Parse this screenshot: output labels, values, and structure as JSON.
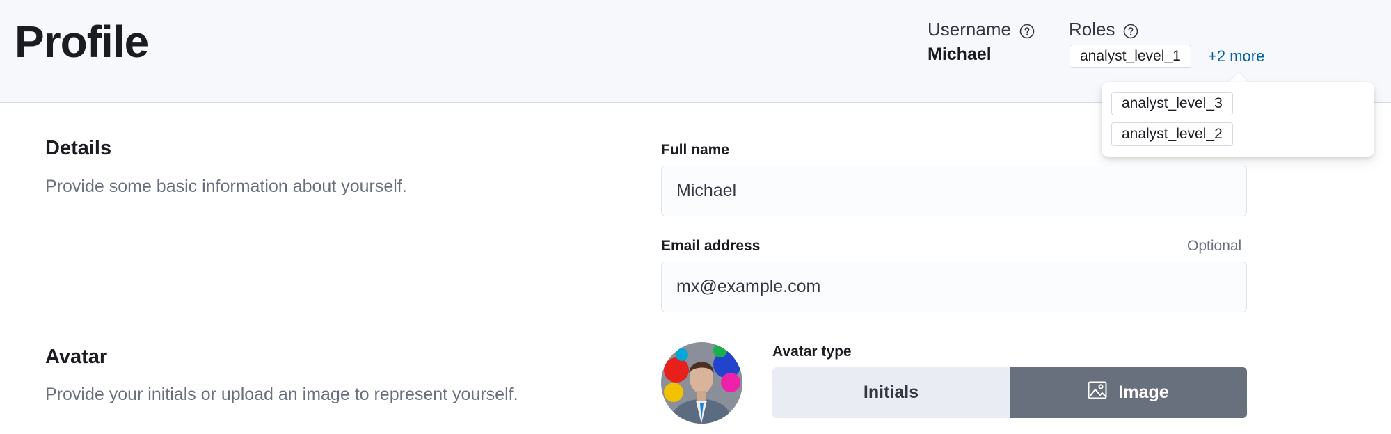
{
  "page": {
    "title": "Profile"
  },
  "header": {
    "username_label": "Username",
    "username_value": "Michael",
    "roles_label": "Roles",
    "roles": [
      "analyst_level_1"
    ],
    "more_link": "+2 more",
    "popover_roles": [
      "analyst_level_3",
      "analyst_level_2"
    ]
  },
  "details": {
    "title": "Details",
    "description": "Provide some basic information about yourself.",
    "full_name_label": "Full name",
    "full_name_value": "Michael",
    "email_label": "Email address",
    "email_optional": "Optional",
    "email_value": "mx@example.com"
  },
  "avatar": {
    "title": "Avatar",
    "description": "Provide your initials or upload an image to represent yourself.",
    "type_label": "Avatar type",
    "options": [
      "Initials",
      "Image"
    ],
    "selected": "Image"
  },
  "colors": {
    "link": "#0061a6",
    "selected_toggle": "#69707d",
    "unselected_toggle": "#e9edf3",
    "header_bg": "#f7f8fc"
  }
}
